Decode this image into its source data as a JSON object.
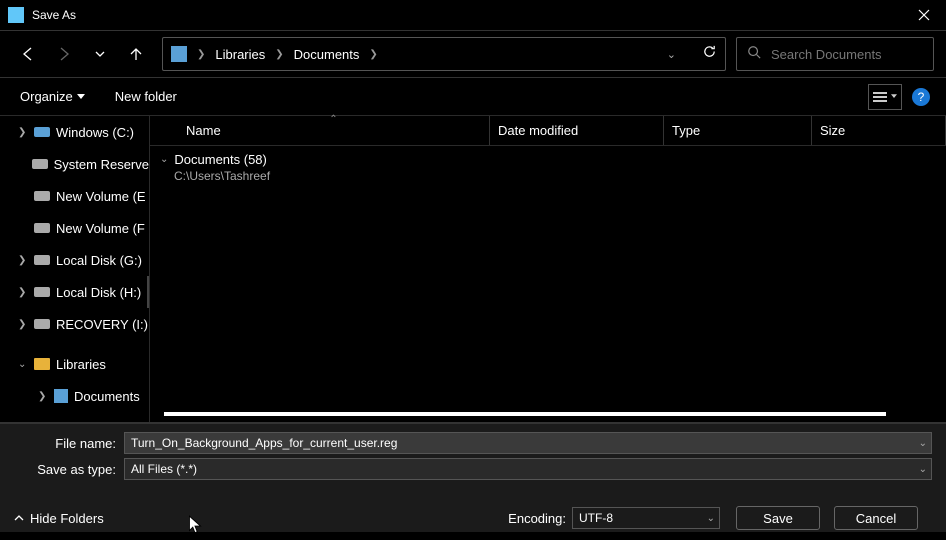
{
  "title": "Save As",
  "breadcrumb": [
    "Libraries",
    "Documents"
  ],
  "search_placeholder": "Search Documents",
  "toolbar": {
    "organize": "Organize",
    "new_folder": "New folder"
  },
  "columns": {
    "name": "Name",
    "date": "Date modified",
    "type": "Type",
    "size": "Size"
  },
  "sidebar": {
    "drives": [
      {
        "label": "Windows (C:)",
        "win": true
      },
      {
        "label": "System Reserve"
      },
      {
        "label": "New Volume (E"
      },
      {
        "label": "New Volume (F"
      },
      {
        "label": "Local Disk (G:)"
      },
      {
        "label": "Local Disk (H:)",
        "selected": true
      },
      {
        "label": "RECOVERY (I:)"
      }
    ],
    "libraries_label": "Libraries",
    "documents_label": "Documents"
  },
  "group": {
    "title": "Documents (58)",
    "sub": "C:\\Users\\Tashreef"
  },
  "form": {
    "file_name_label": "File name:",
    "file_name_value": "Turn_On_Background_Apps_for_current_user.reg",
    "save_type_label": "Save as type:",
    "save_type_value": "All Files  (*.*)",
    "encoding_label": "Encoding:",
    "encoding_value": "UTF-8",
    "save": "Save",
    "cancel": "Cancel",
    "hide_folders": "Hide Folders"
  }
}
